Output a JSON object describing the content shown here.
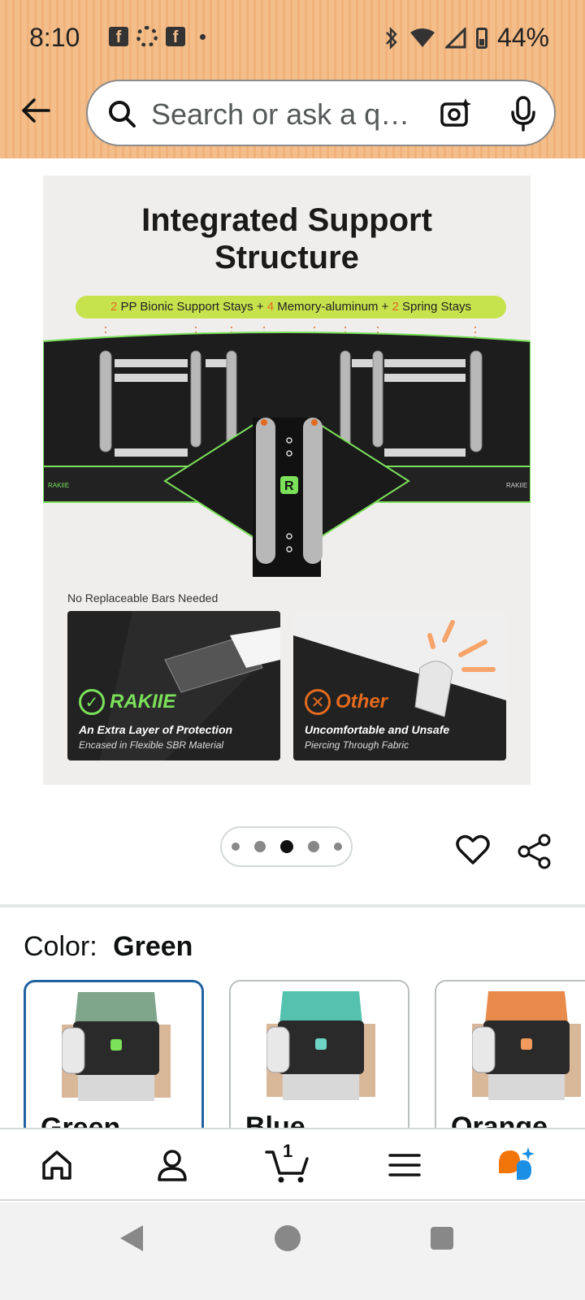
{
  "status_bar": {
    "time": "8:10",
    "battery": "44%",
    "icons": [
      "facebook-icon",
      "settings-icon",
      "facebook-icon",
      "dot-icon",
      "bluetooth-icon",
      "wifi-icon",
      "signal-icon",
      "battery-icon"
    ]
  },
  "header": {
    "back_icon": "back-arrow-icon",
    "search_placeholder": "Search or ask a q…",
    "camera_icon": "camera-scan-icon",
    "mic_icon": "microphone-icon"
  },
  "product_image": {
    "title_line1": "Integrated Support",
    "title_line2": "Structure",
    "banner_n1": "2",
    "banner_t1": " PP Bionic Support Stays + ",
    "banner_n2": "4",
    "banner_t2": " Memory-aluminum + ",
    "banner_n3": "2",
    "banner_t3": " Spring Stays",
    "note": "No Replaceable Bars Needed",
    "card_left": {
      "brand": "RAKIIE",
      "caption": "An Extra Layer of Protection",
      "sub": "Encased in Flexible SBR Material",
      "icon": "check-circle-icon"
    },
    "card_right": {
      "brand": "Other",
      "caption": "Uncomfortable and Unsafe",
      "sub": "Piercing Through Fabric",
      "icon": "x-circle-icon"
    },
    "belt_logo": "R",
    "belt_side_label": "RAKIIE"
  },
  "carousel": {
    "total": 5,
    "active_index": 2
  },
  "actions": {
    "wishlist_icon": "heart-icon",
    "share_icon": "share-icon"
  },
  "color_selector": {
    "label": "Color:",
    "selected": "Green",
    "options": [
      {
        "label": "Green",
        "shirt_color": "#7fa68a"
      },
      {
        "label": "Blue",
        "shirt_color": "#55c2b0"
      },
      {
        "label": "Orange",
        "shirt_color": "#e88a4a"
      }
    ]
  },
  "bottom_nav": {
    "items": [
      "home-icon",
      "account-icon",
      "cart-icon",
      "menu-icon",
      "rufus-ai-icon"
    ],
    "cart_count": "1"
  },
  "colors": {
    "accent_blue": "#2162a1",
    "header_orange": "#f4be8a",
    "banner_green": "#c6e24d",
    "belt_green": "#7be05a"
  }
}
